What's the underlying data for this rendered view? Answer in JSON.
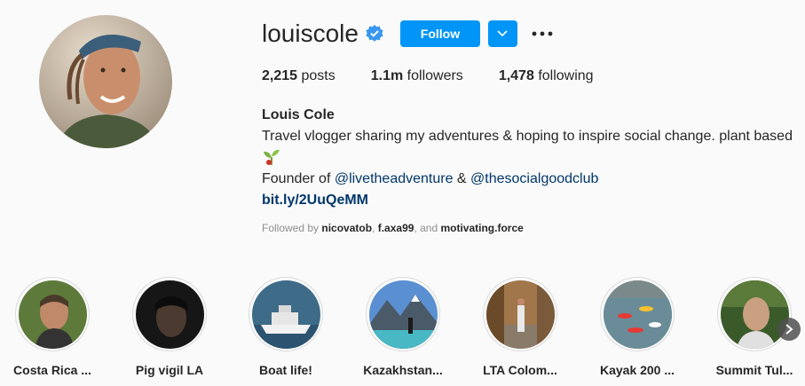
{
  "profile": {
    "username": "louiscole",
    "verified": true,
    "follow_label": "Follow",
    "stats": {
      "posts_value": "2,215",
      "posts_label": "posts",
      "followers_value": "1.1m",
      "followers_label": "followers",
      "following_value": "1,478",
      "following_label": "following"
    },
    "bio": {
      "name": "Louis Cole",
      "line1": "Travel vlogger sharing my adventures & hoping to inspire social change. plant based",
      "founder_prefix": "Founder of ",
      "mention1": "@livetheadventure",
      "amp": " & ",
      "mention2": "@thesocialgoodclub",
      "link": "bit.ly/2UuQeMM"
    },
    "followed_by": {
      "prefix": "Followed by ",
      "user1": "nicovatob",
      "sep1": ", ",
      "user2": "f.axa99",
      "sep2": ", and ",
      "user3": "motivating.force"
    }
  },
  "highlights": [
    {
      "label": "Costa Rica ..."
    },
    {
      "label": "Pig vigil LA"
    },
    {
      "label": "Boat life!"
    },
    {
      "label": "Kazakhstan..."
    },
    {
      "label": "LTA Colom..."
    },
    {
      "label": "Kayak 200 ..."
    },
    {
      "label": "Summit Tul..."
    }
  ],
  "colors": {
    "accent": "#0095f6",
    "link": "#00376b",
    "muted": "#8e8e8e"
  }
}
